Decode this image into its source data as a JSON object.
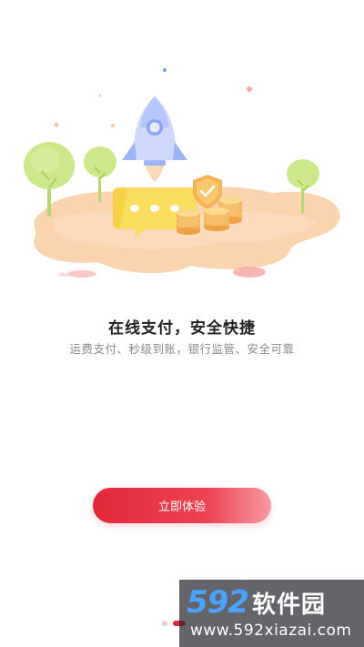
{
  "onboarding": {
    "title": "在线支付，安全快捷",
    "subtitle": "运费支付、秒级到账，银行监管、安全可靠",
    "cta_label": "立即体验",
    "page_count": 2,
    "current_page": 2
  },
  "watermark": {
    "logo_number": "592",
    "logo_text": "软件园",
    "url": "www.592xiazai.com"
  },
  "colors": {
    "accent": "#e2283a",
    "title": "#222222",
    "subtitle": "#8a8a8a",
    "watermark_number": "#4aa3ff"
  },
  "icons": [
    "rocket-icon",
    "chat-bubble-icon",
    "shield-check-icon",
    "coin-stack-icon",
    "tree-icon"
  ]
}
